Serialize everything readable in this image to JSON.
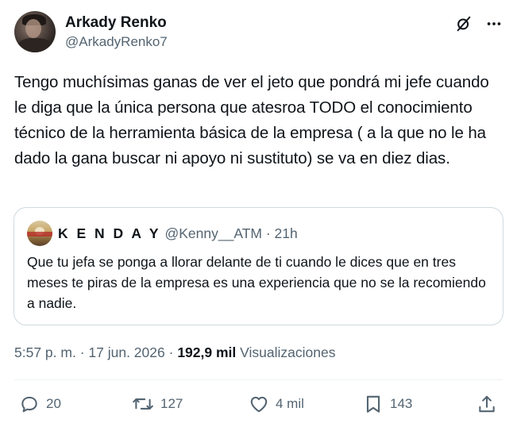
{
  "author": {
    "display_name": "Arkady Renko",
    "handle": "@ArkadyRenko7"
  },
  "header_icons": [
    "grok-icon",
    "more-icon"
  ],
  "tweet": {
    "text": "Tengo muchísimas ganas de ver el jeto que pondrá mi jefe cuando le diga que la única persona que atesroa TODO el conocimiento técnico de la herramienta básica de la empresa ( a la que no le ha dado la gana buscar ni apoyo ni sustituto) se va en diez dias."
  },
  "quote": {
    "display_name": "K E N D A Y",
    "handle": "@Kenny__ATM",
    "separator": "·",
    "time": "21h",
    "text": "Que tu jefa se ponga a llorar delante de ti cuando le dices que en tres meses te piras de la empresa es una experiencia que no se la recomiendo a nadie."
  },
  "meta": {
    "time": "5:57 p. m.",
    "sep1": "·",
    "date": "17 jun. 2026",
    "sep2": "·",
    "views_count": "192,9 mil",
    "views_label": "Visualizaciones"
  },
  "actions": {
    "replies": "20",
    "reposts": "127",
    "likes": "4 mil",
    "bookmarks": "143"
  },
  "colors": {
    "text": "#0f1419",
    "secondary": "#536471",
    "border": "#cfd9de"
  }
}
